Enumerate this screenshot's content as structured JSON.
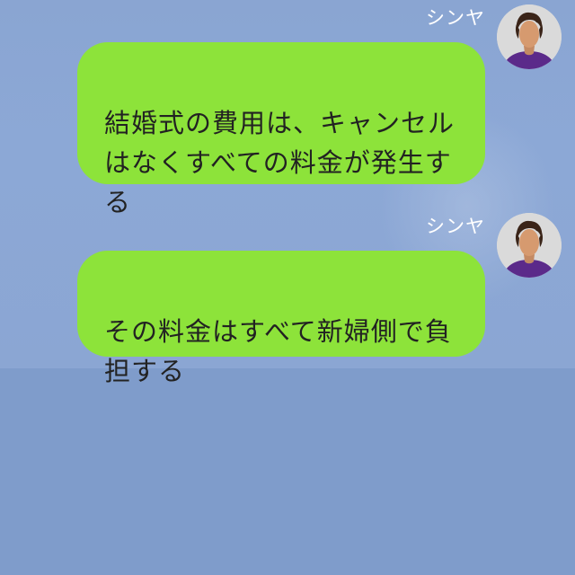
{
  "messages": [
    {
      "sender": "シンヤ",
      "text": "結婚式の費用は、キャンセル\nはなくすべての料金が発生す\nる",
      "avatar_icon": "person-avatar-icon"
    },
    {
      "sender": "シンヤ",
      "text": "その料金はすべて新婦側で負\n担する",
      "avatar_icon": "person-avatar-icon"
    }
  ],
  "colors": {
    "chat_background": "#8aa5d2",
    "lower_background": "#7f9ccb",
    "bubble": "#8de33a",
    "bubble_text": "#222222",
    "sender_name": "#ffffff"
  }
}
